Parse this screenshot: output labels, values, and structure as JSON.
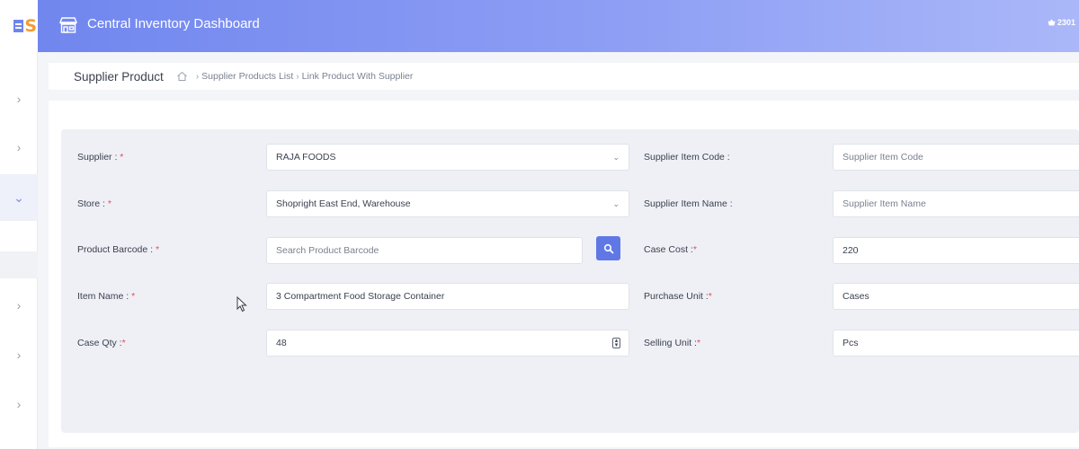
{
  "header": {
    "title": "Central Inventory Dashboard",
    "user_code": "2301",
    "logo_letter": "S",
    "icons": {
      "store": "store-icon",
      "user": "basket-icon"
    }
  },
  "sidebar": {
    "items": [
      {
        "icon": "chevron-right-icon",
        "glyph": "›"
      },
      {
        "icon": "chevron-right-icon",
        "glyph": "›"
      },
      {
        "icon": "chevron-down-icon",
        "glyph": "⌄"
      },
      {
        "icon": "chevron-right-icon",
        "glyph": "›"
      },
      {
        "icon": "chevron-right-icon",
        "glyph": "›"
      },
      {
        "icon": "chevron-right-icon",
        "glyph": "›"
      }
    ]
  },
  "breadcrumb": {
    "page_title": "Supplier Product",
    "sep": "›",
    "links": [
      "Supplier Products List",
      "Link Product With Supplier"
    ]
  },
  "form": {
    "supplier": {
      "label": "Supplier : ",
      "required": "*",
      "value": "RAJA FOODS"
    },
    "store": {
      "label": "Store : ",
      "required": "*",
      "value": "Shopright East End, Warehouse"
    },
    "product_barcode": {
      "label": "Product Barcode : ",
      "required": "*",
      "placeholder": "Search Product Barcode"
    },
    "item_name": {
      "label": "Item Name : ",
      "required": "*",
      "value": "3 Compartment Food Storage Container"
    },
    "case_qty": {
      "label": "Case Qty :",
      "required": "*",
      "value": "48"
    },
    "supplier_item_code": {
      "label": "Supplier Item Code :",
      "placeholder": "Supplier Item Code"
    },
    "supplier_item_name": {
      "label": "Supplier Item Name :",
      "placeholder": "Supplier Item Name"
    },
    "case_cost": {
      "label": "Case Cost :",
      "required": "*",
      "value": "220"
    },
    "purchase_unit": {
      "label": "Purchase Unit :",
      "required": "*",
      "value": "Cases"
    },
    "selling_unit": {
      "label": "Selling Unit :",
      "required": "*",
      "value": "Pcs"
    }
  },
  "colors": {
    "header_start": "#6f85ee",
    "header_end": "#aab7f8",
    "accent": "#5f78e6",
    "required": "#e64c5a",
    "logo": "#f39c33"
  }
}
